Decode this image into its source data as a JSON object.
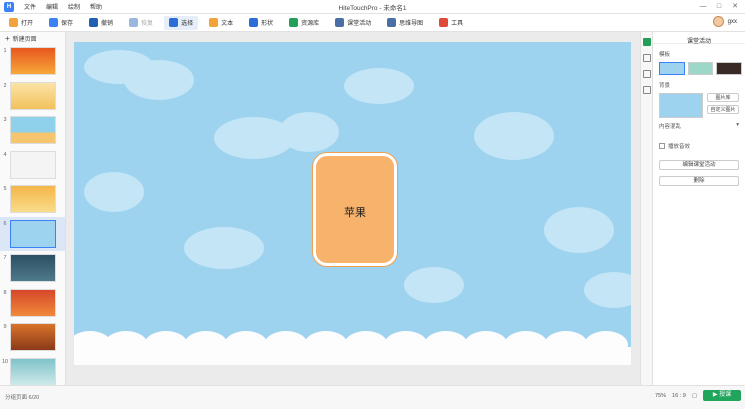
{
  "app": {
    "title": "HiteTouchPro - 未命名1",
    "logo_text": "H",
    "menu": [
      "文件",
      "编辑",
      "绘制",
      "帮助"
    ],
    "window_controls": [
      "—",
      "□",
      "✕"
    ]
  },
  "toolbar": {
    "buttons": [
      {
        "label": "打开",
        "icon": "folder-icon",
        "color": "#f0a43a"
      },
      {
        "label": "保存",
        "icon": "save-icon",
        "color": "#3b82f6"
      },
      {
        "label": "撤销",
        "icon": "undo-icon",
        "color": "#1f5fb5"
      },
      {
        "label": "恢复",
        "icon": "redo-icon",
        "color": "#9ab8df"
      },
      {
        "label": "选择",
        "icon": "cursor-icon",
        "color": "#2b6fd6"
      },
      {
        "label": "文本",
        "icon": "text-icon",
        "color": "#f0a43a"
      },
      {
        "label": "形状",
        "icon": "shape-icon",
        "color": "#2b6fd6"
      },
      {
        "label": "资源库",
        "icon": "library-icon",
        "color": "#22a05a"
      },
      {
        "label": "课堂活动",
        "icon": "activity-icon",
        "color": "#4a6fa5"
      },
      {
        "label": "思维导图",
        "icon": "mindmap-icon",
        "color": "#4a6fa5"
      },
      {
        "label": "工具",
        "icon": "toolbox-icon",
        "color": "#e04a3a"
      }
    ],
    "user": "gxx"
  },
  "slides_panel": {
    "new_page_label": "新建页面",
    "slides": [
      "1",
      "2",
      "3",
      "4",
      "5",
      "6",
      "7",
      "8",
      "9",
      "10"
    ],
    "thumb_colors": [
      "#e8571e",
      "#f2c15c",
      "#8fd0ea",
      "#f4f4f4",
      "#f5b64a",
      "#9ed3ef",
      "#2c4f63",
      "#d6462a",
      "#d8732a",
      "#7fc3c9"
    ],
    "selected_index": 5
  },
  "slide": {
    "card_text": "苹果",
    "background_color": "#9ed3ef",
    "card_color": "#f7b26b"
  },
  "props": {
    "title": "课堂活动",
    "template_label": "模板",
    "template_colors": [
      "#9ed3ef",
      "#9dd7c8",
      "#3a2a25"
    ],
    "background_label": "背景",
    "btn_image_library": "图片库",
    "btn_custom_image": "自定义图片",
    "random_label": "内容混乱",
    "checkbox_label": "播放音效",
    "btn_edit_activity": "编辑课堂活动",
    "btn_delete": "删除"
  },
  "statusbar": {
    "page_info": "分组页面 6/20",
    "zoom": "75%",
    "ratio": "16 : 9",
    "play_label": "▶ 授课"
  }
}
